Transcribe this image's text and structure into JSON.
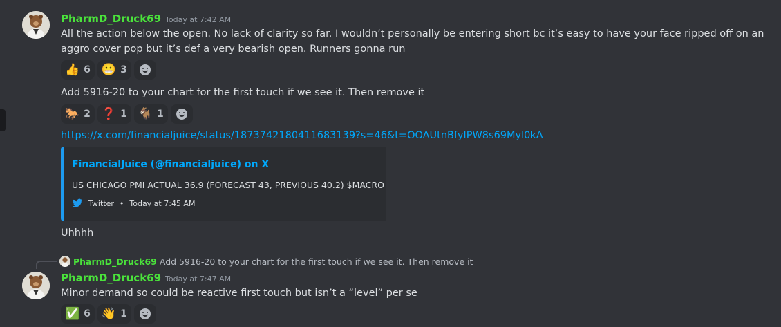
{
  "messages": [
    {
      "username": "PharmD_Druck69",
      "timestamp": "Today at 7:42 AM",
      "text": "All the action below the open. No lack of clarity so far. I wouldn’t personally be entering short bc it’s easy to have your face ripped off on an aggro cover pop but it’s def a very bearish open. Runners gonna run",
      "reactions": [
        {
          "emoji": "👍",
          "count": "6"
        },
        {
          "emoji": "😬",
          "count": "3"
        }
      ]
    },
    {
      "text": "Add 5916-20 to your chart for the first touch if we see it. Then remove it",
      "reactions": [
        {
          "emoji": "🐎",
          "count": "2"
        },
        {
          "emoji": "❓",
          "count": "1"
        },
        {
          "emoji": "🐐",
          "count": "1"
        }
      ]
    },
    {
      "link": "https://x.com/financialjuice/status/1873742180411683139?s=46&t=OOAUtnBfyIPW8s69Myl0kA",
      "embed": {
        "title": "FinancialJuice (@financialjuice) on X",
        "description": "US CHICAGO PMI ACTUAL 36.9 (FORECAST 43, PREVIOUS 40.2) $MACRO",
        "footer_source": "Twitter",
        "footer_time": "Today at 7:45 AM"
      }
    },
    {
      "text": "Uhhhh"
    },
    {
      "reply_to": {
        "username": "PharmD_Druck69",
        "text": "Add 5916-20 to your chart for the first touch if we see it. Then remove it"
      },
      "username": "PharmD_Druck69",
      "timestamp": "Today at 7:47 AM",
      "text": "Minor demand so could be reactive first touch but isn’t a “level” per se",
      "reactions": [
        {
          "emoji": "✅",
          "count": "6"
        },
        {
          "emoji": "👋",
          "count": "1"
        }
      ]
    }
  ],
  "colors": {
    "background": "#313338",
    "username": "#4ae23b",
    "link": "#00a8fc",
    "embed_border": "#1d9bf0"
  },
  "icons": {
    "add_reaction": "smile-icon",
    "twitter": "twitter-icon"
  },
  "embed_footer_separator": "•"
}
